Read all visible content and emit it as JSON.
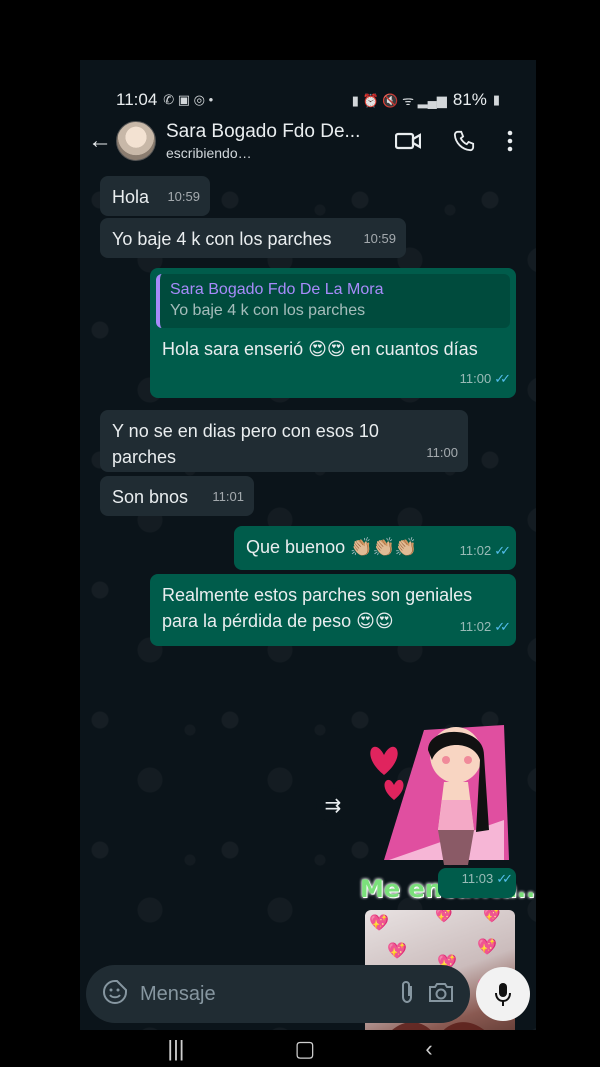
{
  "status_bar": {
    "time": "11:04",
    "battery": "81%"
  },
  "header": {
    "contact_name": "Sara Bogado Fdo De...",
    "subtitle": "escribiendo…"
  },
  "messages": [
    {
      "direction": "in",
      "text": "Hola",
      "time": "10:59"
    },
    {
      "direction": "in",
      "text": "Yo baje 4 k con los parches",
      "time": "10:59"
    },
    {
      "direction": "out",
      "quote_name": "Sara Bogado Fdo De La Mora",
      "quote_text": "Yo baje 4 k con los parches",
      "text": "Hola sara enserió 😍😍  en cuantos días",
      "time": "11:00"
    },
    {
      "direction": "in",
      "text": "Y no se en dias pero con esos 10 parches",
      "time": "11:00"
    },
    {
      "direction": "in",
      "text": "Son bnos",
      "time": "11:01"
    },
    {
      "direction": "out",
      "text": "Que buenoo 👏🏼👏🏼👏🏼",
      "time": "11:02"
    },
    {
      "direction": "out",
      "text": "Realmente estos parches son geniales para la pérdida de peso 😍😍",
      "time": "11:02"
    },
    {
      "direction": "out",
      "type": "sticker",
      "sticker_text": "Me encanta..",
      "time": "11:03"
    },
    {
      "direction": "out",
      "type": "image"
    }
  ],
  "input": {
    "placeholder": "Mensaje"
  },
  "colors": {
    "incoming": "#202c33",
    "outgoing": "#005c4b",
    "read_ticks": "#53bdeb"
  }
}
